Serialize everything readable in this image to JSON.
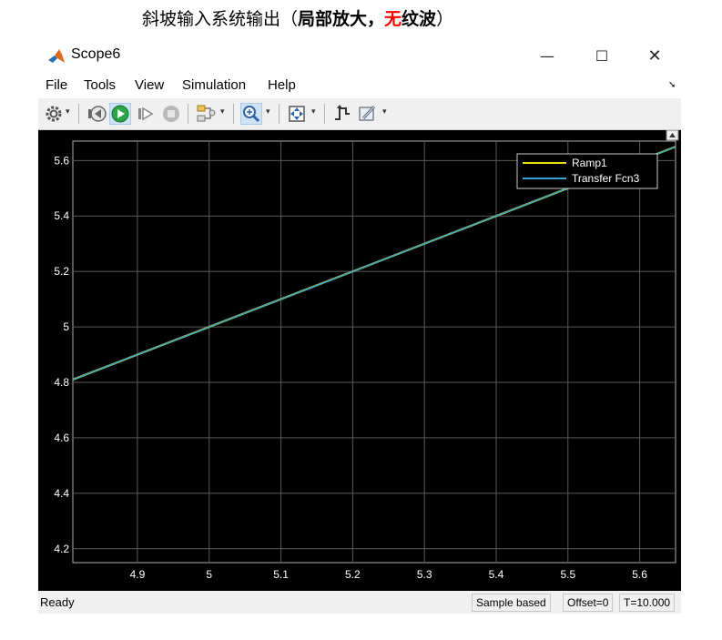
{
  "caption": {
    "part1": "斜坡输入系统输出（",
    "part2": "局部放大，",
    "part3": "无",
    "part4": "纹波",
    "part5": "）"
  },
  "window": {
    "title": "Scope6",
    "controls": {
      "minimize": "—",
      "maximize": "☐",
      "close": "✕"
    }
  },
  "menu": {
    "file": "File",
    "tools": "Tools",
    "view": "View",
    "simulation": "Simulation",
    "help": "Help"
  },
  "status": {
    "ready": "Ready",
    "sample_mode": "Sample based",
    "offset": "Offset=0",
    "time": "T=10.000"
  },
  "colors": {
    "ramp": "#e8e000",
    "transfer": "#35a6d4",
    "grid": "#5a5a5a",
    "background": "#000000",
    "ticks": "#ffffff"
  },
  "chart_data": {
    "type": "line",
    "xlim": [
      4.81,
      5.65
    ],
    "ylim": [
      4.15,
      5.67
    ],
    "xticks": [
      4.9,
      5.0,
      5.1,
      5.2,
      5.3,
      5.4,
      5.5,
      5.6
    ],
    "xtick_labels": [
      "4.9",
      "5",
      "5.1",
      "5.2",
      "5.3",
      "5.4",
      "5.5",
      "5.6"
    ],
    "yticks": [
      4.2,
      4.4,
      4.6,
      4.8,
      5.0,
      5.2,
      5.4,
      5.6
    ],
    "ytick_labels": [
      "4.2",
      "4.4",
      "4.6",
      "4.8",
      "5",
      "5.2",
      "5.4",
      "5.6"
    ],
    "grid": true,
    "legend_position": "top-right",
    "series": [
      {
        "name": "Ramp1",
        "x": [
          4.81,
          5.65
        ],
        "y": [
          4.81,
          5.65
        ],
        "color": "#e8e000"
      },
      {
        "name": "Transfer Fcn3",
        "x": [
          4.81,
          5.65
        ],
        "y": [
          4.81,
          5.65
        ],
        "color": "#35a6d4"
      }
    ]
  }
}
